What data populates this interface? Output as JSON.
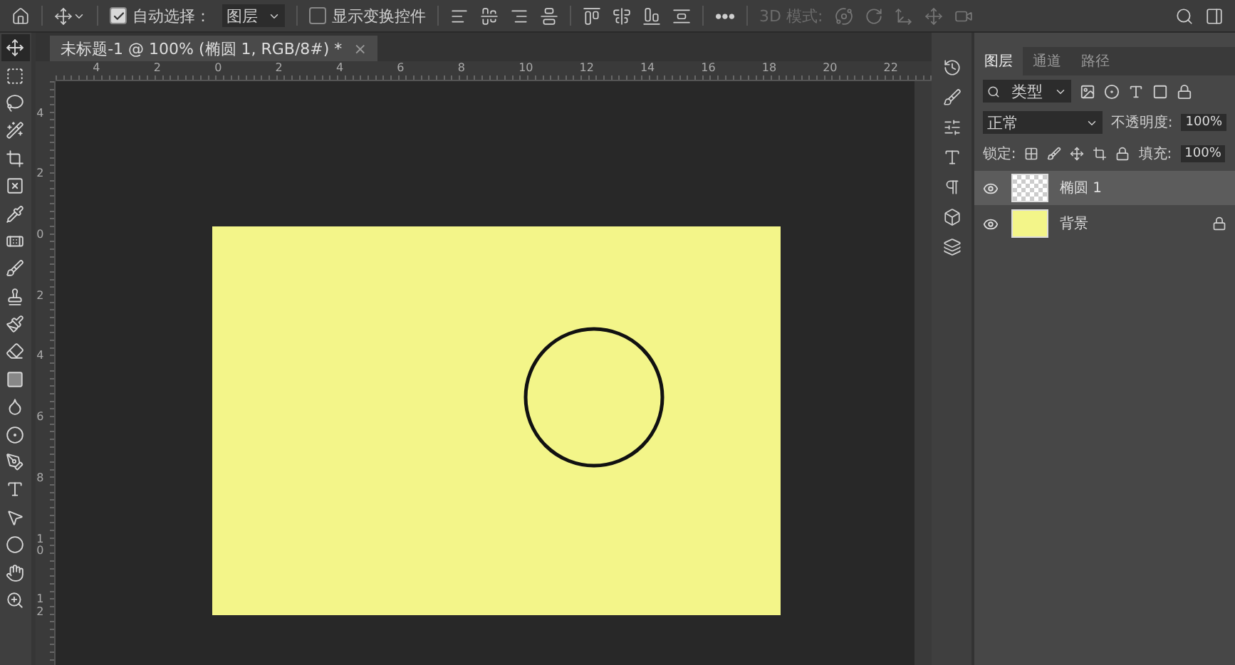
{
  "options_bar": {
    "auto_select": {
      "label": "自动选择：",
      "checked": true
    },
    "auto_select_target": "图层",
    "show_transform": {
      "label": "显示变换控件",
      "checked": false
    },
    "more": "•••",
    "mode_3d": {
      "label": "3D 模式:",
      "disabled": true
    }
  },
  "document_tab": {
    "title": "未标题-1 @ 100% (椭圆 1, RGB/8#) *",
    "close": "×",
    "selected": true
  },
  "tools": [
    {
      "kind": "move",
      "selected": true
    },
    {
      "kind": "marquee",
      "selected": false
    },
    {
      "kind": "lasso",
      "selected": false
    },
    {
      "kind": "wand",
      "selected": false
    },
    {
      "kind": "crop",
      "selected": false
    },
    {
      "kind": "frame",
      "selected": false
    },
    {
      "kind": "eyedropper",
      "selected": false
    },
    {
      "kind": "healing",
      "selected": false
    },
    {
      "kind": "brush",
      "selected": false
    },
    {
      "kind": "stamp",
      "selected": false
    },
    {
      "kind": "history",
      "selected": false
    },
    {
      "kind": "eraser",
      "selected": false
    },
    {
      "kind": "gradient",
      "selected": false
    },
    {
      "kind": "blur",
      "selected": false
    },
    {
      "kind": "dodge",
      "selected": false
    },
    {
      "kind": "pen",
      "selected": false
    },
    {
      "kind": "type",
      "selected": false
    },
    {
      "kind": "select",
      "selected": false
    },
    {
      "kind": "ellipse",
      "selected": false
    },
    {
      "kind": "hand",
      "selected": false
    },
    {
      "kind": "zoom",
      "selected": false
    }
  ],
  "horizontal_ruler": [
    "4",
    "2",
    "0",
    "2",
    "4",
    "6",
    "8",
    "10",
    "12",
    "14",
    "16",
    "18",
    "20",
    "22"
  ],
  "vertical_ruler": [
    "4",
    "2",
    "0",
    "2",
    "4",
    "6",
    "8",
    "10",
    "12"
  ],
  "panel_tabs": [
    {
      "label": "图层",
      "selected": true
    },
    {
      "label": "通道",
      "selected": false
    },
    {
      "label": "路径",
      "selected": false
    }
  ],
  "layers_panel": {
    "filter": "类型",
    "blend_mode": "正常",
    "opacity_label": "不透明度:",
    "opacity": "100%",
    "lock_label": "锁定:",
    "fill_label": "填充:",
    "fill": "100%"
  },
  "layers": [
    {
      "name": "椭圆 1",
      "kind": "shape",
      "visible": true,
      "selected": true,
      "locked": false
    },
    {
      "name": "背景",
      "kind": "fill",
      "visible": true,
      "selected": false,
      "locked": true
    }
  ]
}
